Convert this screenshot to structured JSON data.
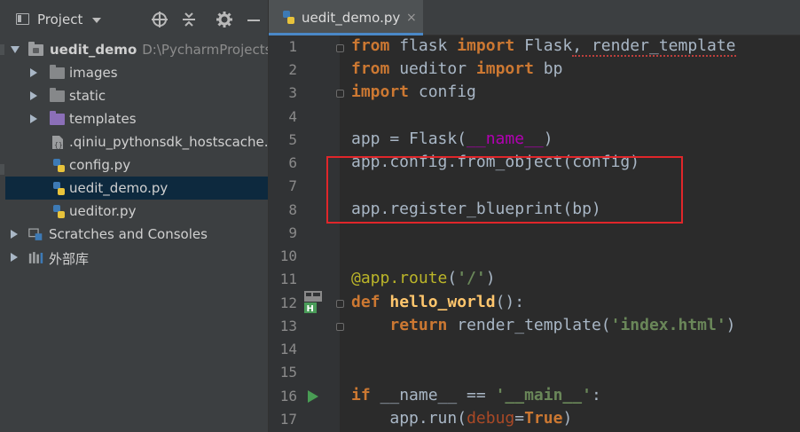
{
  "project_panel": {
    "title": "Project",
    "tree": [
      {
        "label": "uedit_demo",
        "path": "D:\\PycharmProjects\\",
        "type": "folder-root",
        "expanded": true
      },
      {
        "label": "images",
        "type": "folder"
      },
      {
        "label": "static",
        "type": "folder"
      },
      {
        "label": "templates",
        "type": "folder-purple"
      },
      {
        "label": ".qiniu_pythonsdk_hostscache.js",
        "type": "file-json"
      },
      {
        "label": "config.py",
        "type": "file-py"
      },
      {
        "label": "uedit_demo.py",
        "type": "file-py",
        "selected": true
      },
      {
        "label": "ueditor.py",
        "type": "file-py"
      },
      {
        "label": "Scratches and Consoles",
        "type": "scratches"
      },
      {
        "label": "外部库",
        "type": "library"
      }
    ]
  },
  "editor": {
    "tab_label": "uedit_demo.py",
    "tab_close": "×",
    "line_numbers": [
      "1",
      "2",
      "3",
      "4",
      "5",
      "6",
      "7",
      "8",
      "9",
      "10",
      "11",
      "12",
      "13",
      "14",
      "15",
      "16",
      "17"
    ],
    "code": {
      "l1": {
        "k1": "from",
        "a": " flask ",
        "k2": "import",
        "b": " Flask",
        "c": ", render_template"
      },
      "l2": {
        "k1": "from",
        "a": " ueditor ",
        "k2": "import",
        "b": " bp"
      },
      "l3": {
        "k1": "import",
        "a": " config"
      },
      "l5": {
        "a": "app = Flask(",
        "m": "__name__",
        "b": ")"
      },
      "l6": {
        "a": "app.config.from_object(config)"
      },
      "l8": {
        "a": "app.register_blueprint(bp)"
      },
      "l11": {
        "d": "@app.route",
        "a": "(",
        "s": "'/'",
        "b": ")"
      },
      "l12": {
        "k": "def",
        "sp": " ",
        "f": "hello_world",
        "a": "():"
      },
      "l13": {
        "ind": "    ",
        "k": "return",
        "a": " render_template(",
        "s": "'index.html'",
        "b": ")"
      },
      "l16": {
        "k": "if",
        "a": " __name__ == ",
        "s": "'__main__'",
        "b": ":"
      },
      "l17": {
        "ind": "    ",
        "a": "app.run(",
        "p": "debug",
        "e": "=",
        "k": "True",
        "b": ")"
      }
    }
  },
  "colors": {
    "keyword": "#cc7832",
    "string": "#6a8759",
    "decorator": "#bbb529",
    "function": "#ffc66d",
    "highlight_box": "#e0262a",
    "selection": "#0d293e"
  }
}
